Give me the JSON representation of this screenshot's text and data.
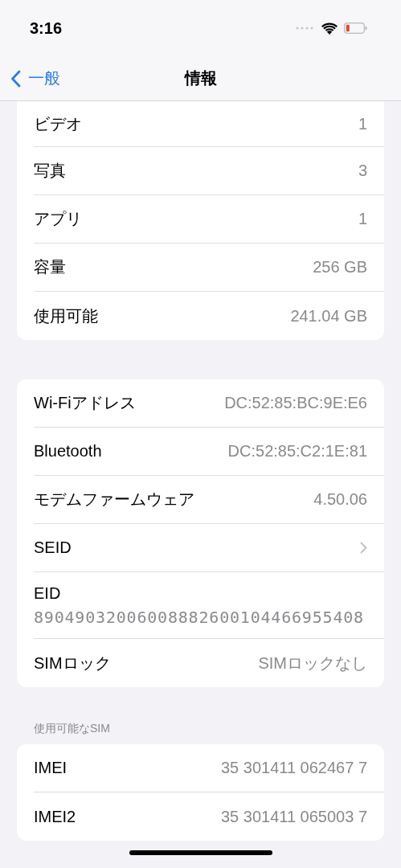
{
  "status_bar": {
    "time": "3:16"
  },
  "nav": {
    "back": "一般",
    "title": "情報"
  },
  "sections": [
    {
      "rows": [
        {
          "kind": "value",
          "label": "ビデオ",
          "value": "1"
        },
        {
          "kind": "value",
          "label": "写真",
          "value": "3"
        },
        {
          "kind": "value",
          "label": "アプリ",
          "value": "1"
        },
        {
          "kind": "value",
          "label": "容量",
          "value": "256 GB"
        },
        {
          "kind": "value",
          "label": "使用可能",
          "value": "241.04 GB"
        }
      ]
    },
    {
      "rows": [
        {
          "kind": "value",
          "label": "Wi-Fiアドレス",
          "value": "DC:52:85:BC:9E:E6"
        },
        {
          "kind": "value",
          "label": "Bluetooth",
          "value": "DC:52:85:C2:1E:81"
        },
        {
          "kind": "value",
          "label": "モデムファームウェア",
          "value": "4.50.06"
        },
        {
          "kind": "link",
          "label": "SEID"
        },
        {
          "kind": "stacked",
          "label": "EID",
          "value": "89049032006008882600104466955408"
        },
        {
          "kind": "value",
          "label": "SIMロック",
          "value": "SIMロックなし"
        }
      ]
    },
    {
      "header": "使用可能なSIM",
      "rows": [
        {
          "kind": "value",
          "label": "IMEI",
          "value": "35 301411 062467 7"
        },
        {
          "kind": "value",
          "label": "IMEI2",
          "value": "35 301411 065003 7"
        }
      ]
    }
  ]
}
